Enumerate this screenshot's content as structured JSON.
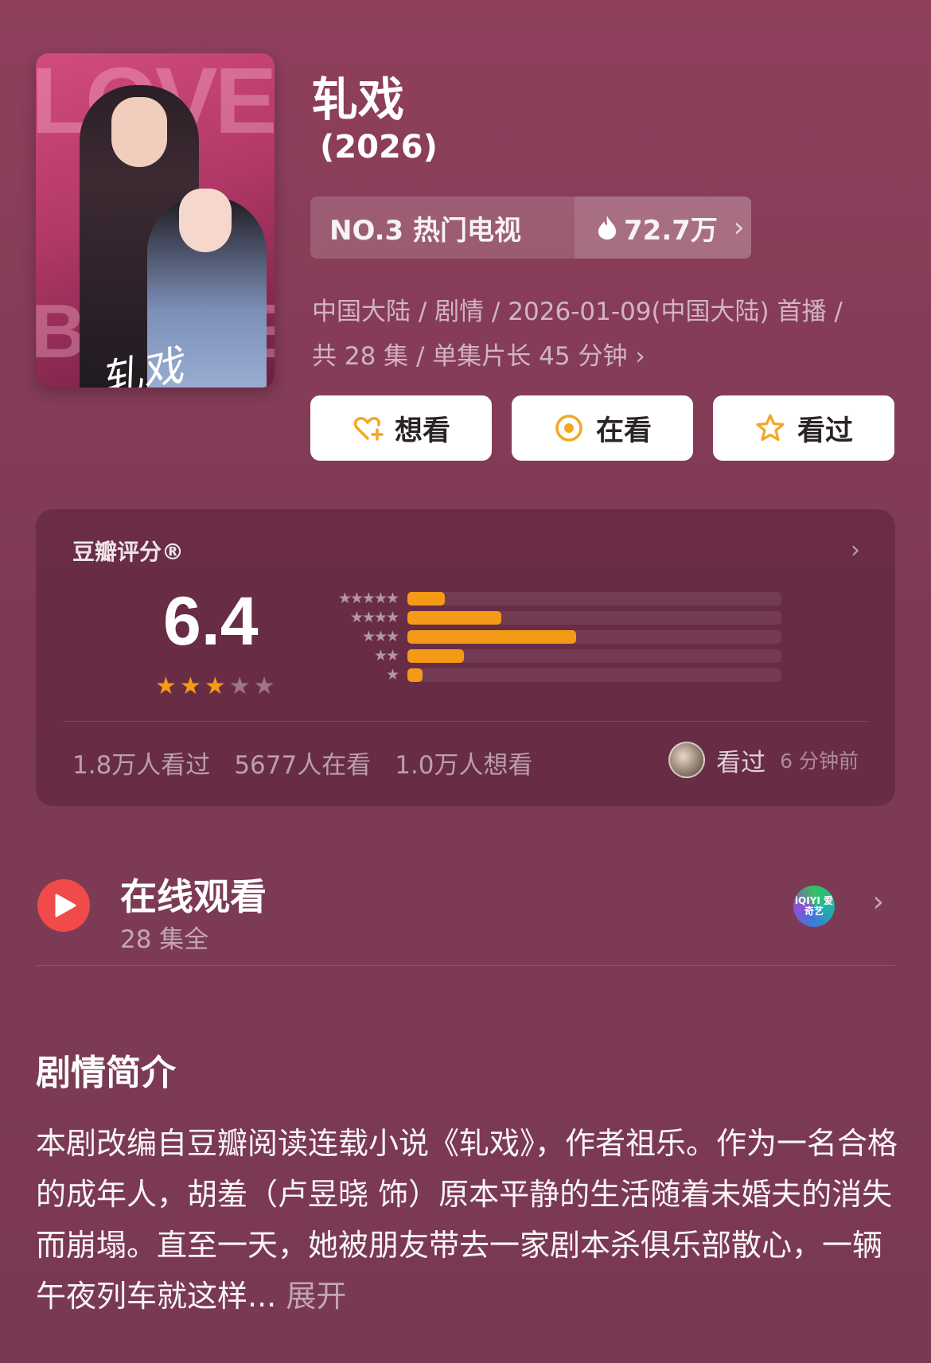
{
  "poster": {
    "caption": "轧戏"
  },
  "title": "轧戏",
  "year": "(2026)",
  "ranking": {
    "rank_text": "NO.3 热门电视",
    "heat": "72.7万"
  },
  "meta": {
    "line1": "中国大陆 / 剧情 / 2026-01-09(中国大陆) 首播 /",
    "line2": "共 28 集 / 单集片长 45 分钟"
  },
  "actions": [
    {
      "label": "想看",
      "icon": "heart-plus-icon"
    },
    {
      "label": "在看",
      "icon": "target-icon"
    },
    {
      "label": "看过",
      "icon": "star-icon"
    }
  ],
  "rating": {
    "label": "豆瓣评分®",
    "score": "6.4",
    "stars_filled": 3,
    "stars_total": 5,
    "distribution": [
      {
        "stars": "★★★★★",
        "fraction": 0.1
      },
      {
        "stars": "★★★★",
        "fraction": 0.25
      },
      {
        "stars": "★★★",
        "fraction": 0.45
      },
      {
        "stars": "★★",
        "fraction": 0.15
      },
      {
        "stars": "★",
        "fraction": 0.04
      }
    ],
    "stats": [
      "1.8万人看过",
      "5677人在看",
      "1.0万人想看"
    ],
    "recent_action": "看过",
    "recent_time": "6 分钟前"
  },
  "online": {
    "title": "在线观看",
    "subtitle": "28 集全",
    "platform": "iQIYI 爱奇艺"
  },
  "synopsis": {
    "title": "剧情简介",
    "text": "本剧改编自豆瓣阅读连载小说《轧戏》，作者祖乐。作为一名合格的成年人，胡羞（卢昱晓 饰）原本平静的生活随着未婚夫的消失而崩塌。直至一天，她被朋友带去一家剧本杀俱乐部散心，一辆午夜列车就这样...",
    "more": "展开"
  },
  "colors": {
    "accent": "#f59a16",
    "play": "#f04a4a",
    "background": "#8f3f5c"
  }
}
